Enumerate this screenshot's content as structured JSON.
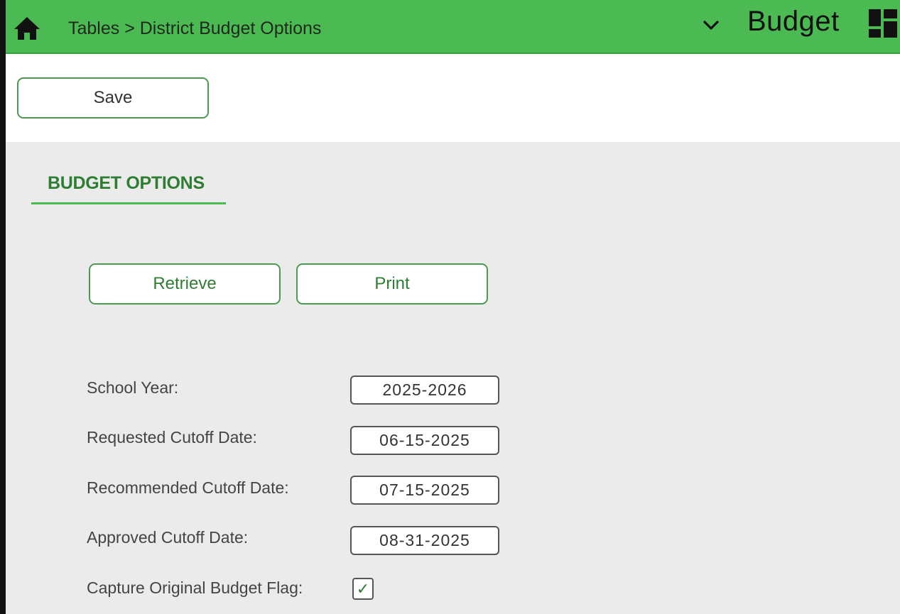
{
  "header": {
    "breadcrumb": "Tables > District Budget Options",
    "module_title": "Budget",
    "bar_color": "#4cba52"
  },
  "toolbar": {
    "save_label": "Save"
  },
  "tab": {
    "label": "BUDGET OPTIONS"
  },
  "actions": {
    "retrieve_label": "Retrieve",
    "print_label": "Print"
  },
  "fields": [
    {
      "label": "School Year:",
      "value": "2025-2026"
    },
    {
      "label": "Requested Cutoff Date:",
      "value": "06-15-2025"
    },
    {
      "label": "Recommended Cutoff Date:",
      "value": "07-15-2025"
    },
    {
      "label": "Approved Cutoff Date:",
      "value": "08-31-2025"
    }
  ],
  "capture_flag": {
    "label": "Capture Original Budget Flag:",
    "checked": true,
    "check_glyph": "✓"
  },
  "icons": {
    "home": "home-icon",
    "chevron": "chevron-down-icon",
    "grid": "dashboard-grid-icon"
  },
  "colors": {
    "accent": "#4cba52",
    "button_border": "#4c9a52",
    "tab_text": "#2e7d32",
    "content_bg": "#ebebeb"
  }
}
